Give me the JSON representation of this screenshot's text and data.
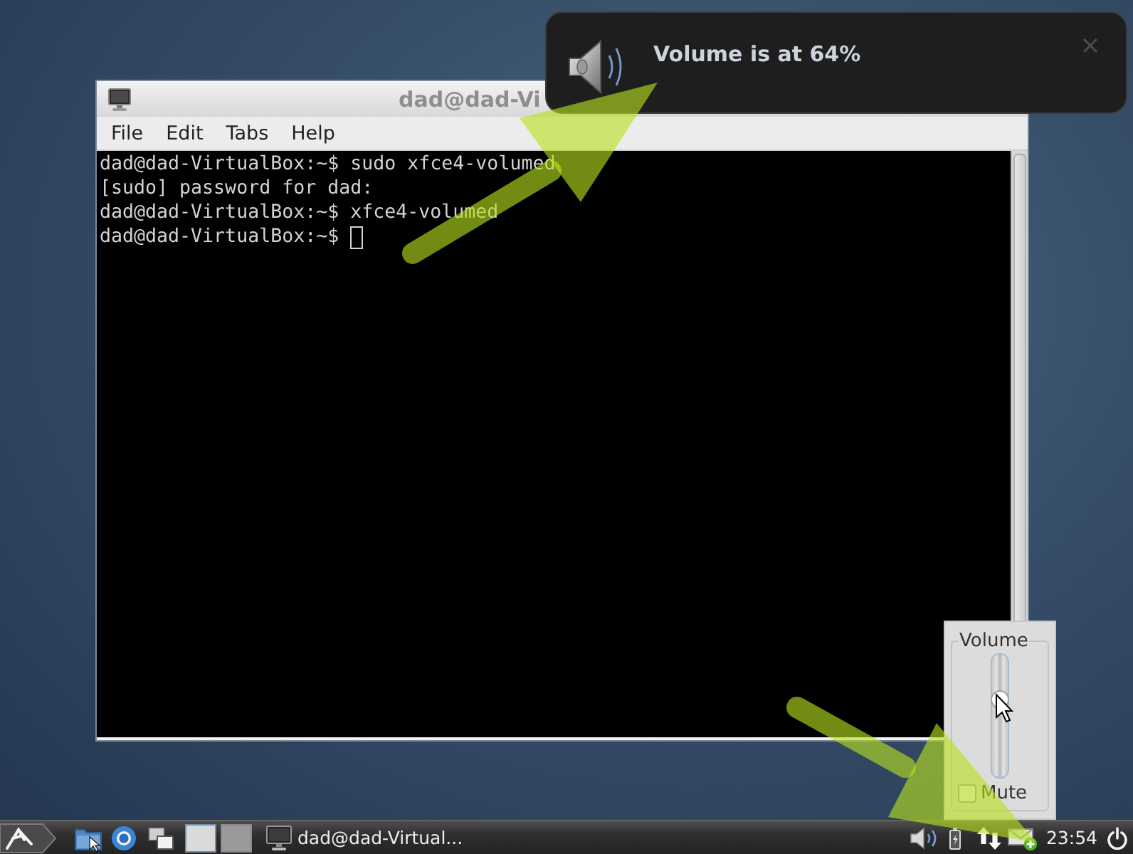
{
  "terminal": {
    "title": "dad@dad-Vi",
    "menu": [
      "File",
      "Edit",
      "Tabs",
      "Help"
    ],
    "lines": [
      {
        "text": "dad@dad-VirtualBox:~$ sudo xfce4-volumed",
        "cursor": false
      },
      {
        "text": "[sudo] password for dad:",
        "cursor": false
      },
      {
        "text": "dad@dad-VirtualBox:~$ xfce4-volumed",
        "cursor": false
      },
      {
        "text": "dad@dad-VirtualBox:~$",
        "cursor": true
      }
    ]
  },
  "notification": {
    "message": "Volume is at 64%"
  },
  "volume_popup": {
    "legend": "Volume",
    "level": 0.64,
    "mute": {
      "label": "Mute",
      "checked": false
    }
  },
  "taskbar": {
    "workspaces": [
      {
        "selected": true
      },
      {
        "selected": false
      }
    ],
    "task": "dad@dad-Virtual...",
    "clock": "23:54"
  }
}
